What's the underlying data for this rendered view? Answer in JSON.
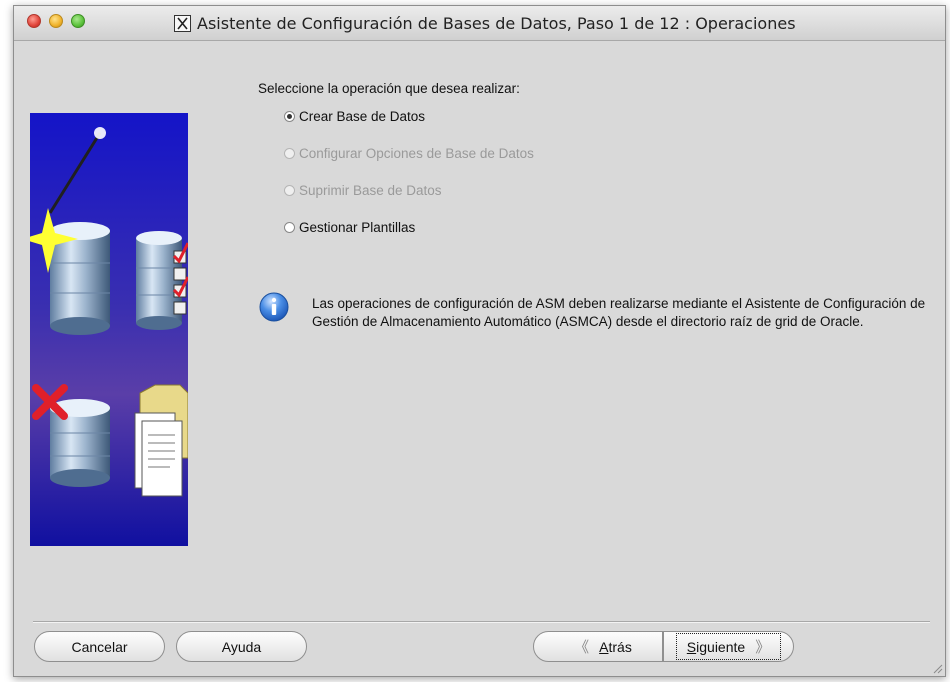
{
  "window": {
    "title": "Asistente de Configuración de Bases de Datos, Paso 1 de 12 : Operaciones"
  },
  "main": {
    "prompt": "Seleccione la operación que desea realizar:",
    "options": [
      {
        "label": "Crear Base de Datos",
        "checked": true,
        "enabled": true
      },
      {
        "label": "Configurar Opciones de Base de Datos",
        "checked": false,
        "enabled": false
      },
      {
        "label": "Suprimir Base de Datos",
        "checked": false,
        "enabled": false
      },
      {
        "label": "Gestionar Plantillas",
        "checked": false,
        "enabled": true
      }
    ],
    "info_message": "Las operaciones de configuración de ASM deben realizarse mediante el Asistente de Configuración de Gestión de Almacenamiento Automático (ASMCA) desde el directorio raíz de grid de Oracle."
  },
  "buttons": {
    "cancel": "Cancelar",
    "help": "Ayuda",
    "back": "Atrás",
    "next": "Siguiente"
  },
  "icons": {
    "window_icon": "x-window-icon",
    "info": "info-icon",
    "back_arrow": "back-arrow-icon",
    "next_arrow": "next-arrow-icon"
  },
  "colors": {
    "window_bg": "#d9d9d9",
    "info_blue": "#2f74d0",
    "side_panel_blue": "#1c1cb8"
  }
}
